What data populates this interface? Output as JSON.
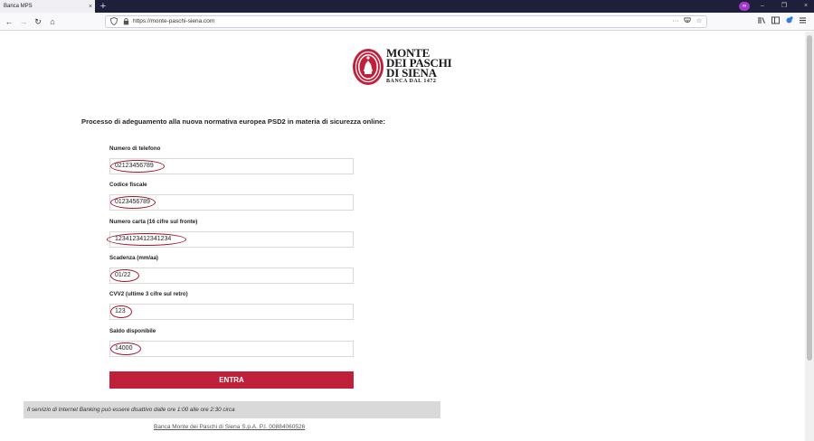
{
  "browser": {
    "tab_title": "Banca MPS",
    "tab_close": "×",
    "new_tab": "+",
    "extension_badge": "∞",
    "window_controls": [
      "–",
      "❐",
      "×"
    ],
    "nav": {
      "back": "←",
      "forward": "→",
      "reload": "↻",
      "home": "⌂"
    },
    "url": "https://monte-paschi-siena.com",
    "url_icons": {
      "shield": "shield-icon",
      "lock": "lock-icon"
    },
    "url_actions": [
      "···",
      "pocket-icon",
      "☆"
    ],
    "toolbar_icons": [
      "library-icon",
      "sidebar-icon",
      "extension-icon",
      "menu-icon"
    ]
  },
  "page": {
    "logo": {
      "line1": "MONTE",
      "line2": "DEI PASCHI",
      "line3": "DI SIENA",
      "tagline": "BANCA DAL 1472"
    },
    "heading": "Processo di adeguamento alla nuova normativa europea PSD2 in materia di sicurezza online:",
    "fields": [
      {
        "label": "Numero di telefono",
        "value": "02123456789"
      },
      {
        "label": "Codice fiscale",
        "value": "0123456789"
      },
      {
        "label": "Numero carta (16 cifre sul fronte)",
        "value": "1234123412341234"
      },
      {
        "label": "Scadenza (mm/aa)",
        "value": "01/22"
      },
      {
        "label": "CVV2 (ultime 3 cifre sul retro)",
        "value": "123"
      },
      {
        "label": "Saldo disponibile",
        "value": "14000"
      }
    ],
    "submit_label": "ENTRA",
    "notice": "Il servizio di Internet Banking può essere disattivo dalle ore 1:00 alle ore 2:30 circa",
    "footer_link": "Banca Monte dei Paschi di Siena S.p.A. P.I. 00884060526"
  },
  "colors": {
    "brand_red": "#c1203b",
    "annotation_red": "#a3152b",
    "chrome_dark": "#1e1f3a"
  }
}
